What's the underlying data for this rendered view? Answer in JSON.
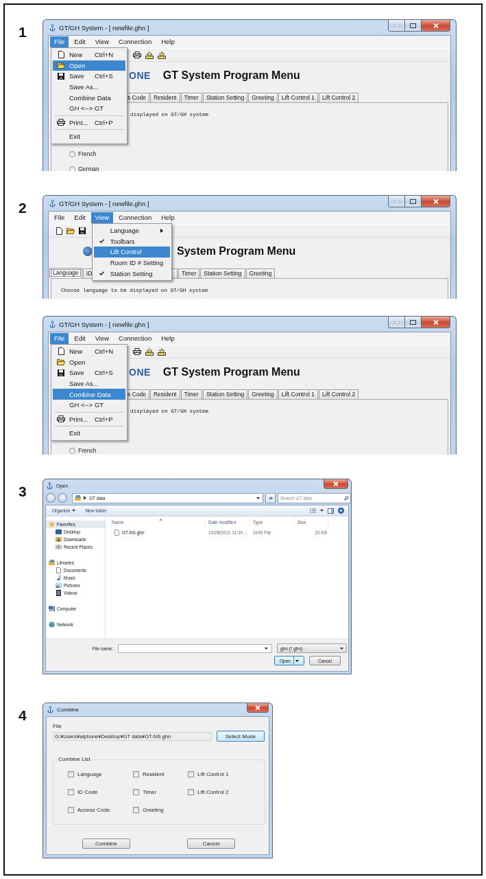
{
  "steps": [
    {
      "number": "1",
      "windows": [
        {
          "kind": "app",
          "title": "GT/GH System - [ newfile.ghn ]",
          "menubar": [
            {
              "label": "File",
              "selected": true,
              "dropdown": [
                {
                  "kind": "new",
                  "label": "New",
                  "shortcut": "Ctrl+N",
                  "selected": false
                },
                {
                  "kind": "open",
                  "label": "Open",
                  "selected": true
                },
                {
                  "kind": "save",
                  "label": "Save",
                  "shortcut": "Ctrl+S",
                  "selected": false
                },
                {
                  "kind": "plain",
                  "label": "Save As...",
                  "selected": false
                },
                {
                  "kind": "plain",
                  "label": "Combine Data",
                  "selected": false
                },
                {
                  "kind": "plain",
                  "label": "GH <--> GT",
                  "selected": false
                },
                {
                  "kind": "separator"
                },
                {
                  "kind": "print",
                  "label": "Print...",
                  "shortcut": "Ctrl+P",
                  "selected": false
                },
                {
                  "kind": "separator"
                },
                {
                  "kind": "plain",
                  "label": "Exit",
                  "selected": false
                }
              ]
            },
            {
              "label": "Edit",
              "selected": false
            },
            {
              "label": "View",
              "selected": false
            },
            {
              "label": "Connection",
              "selected": false
            },
            {
              "label": "Help",
              "selected": false
            }
          ],
          "toolbar": [
            {
              "kind": "print"
            },
            {
              "kind": "upload"
            },
            {
              "kind": "download"
            }
          ],
          "logo_text": "ONE",
          "heading": "GT System Program Menu",
          "tabs": [
            {
              "label": "s Code",
              "selected": false
            },
            {
              "label": "Resident",
              "selected": false
            },
            {
              "label": "Timer",
              "selected": false
            },
            {
              "label": "Station Setting",
              "selected": false
            },
            {
              "label": "Greeting",
              "selected": false
            },
            {
              "label": "Lift Control 1",
              "selected": false
            },
            {
              "label": "Lift Control 2",
              "selected": false
            }
          ],
          "prompt": "displayed on GT/GH system",
          "options": [
            {
              "label": "French",
              "selected": false
            },
            {
              "label": "German",
              "selected": false
            }
          ]
        }
      ]
    },
    {
      "number": "2",
      "windows": [
        {
          "kind": "app",
          "title": "GT/GH System - [ newfile.ghn ]",
          "menubar": [
            {
              "label": "File",
              "selected": false
            },
            {
              "label": "Edit",
              "selected": false
            },
            {
              "label": "View",
              "selected": true,
              "dropdown": [
                {
                  "kind": "check",
                  "label": "Language",
                  "submenu": true,
                  "checked": false,
                  "selected": false
                },
                {
                  "kind": "check",
                  "label": "Toolbars",
                  "checked": true,
                  "selected": false
                },
                {
                  "kind": "check",
                  "label": "Lift Control",
                  "checked": false,
                  "selected": true
                },
                {
                  "kind": "check",
                  "label": "Room ID # Setting",
                  "checked": false,
                  "selected": false
                },
                {
                  "kind": "check",
                  "label": "Station Setting",
                  "checked": true,
                  "selected": false
                }
              ]
            },
            {
              "label": "Connection",
              "selected": false
            },
            {
              "label": "Help",
              "selected": false
            }
          ],
          "toolbar": [
            {
              "kind": "new"
            },
            {
              "kind": "open"
            },
            {
              "kind": "save"
            }
          ],
          "logo_emblem": true,
          "heading": "System Program Menu",
          "tabs": [
            {
              "label": "Language",
              "selected": true
            },
            {
              "label": "ID",
              "selected": false
            },
            {
              "label": "Timer",
              "selected": false
            },
            {
              "label": "Station Setting",
              "selected": false
            },
            {
              "label": "Greeting",
              "selected": false
            }
          ],
          "prompt": "Choose language to be displayed on GT/GH system"
        },
        {
          "kind": "app",
          "title": "GT/GH System - [ newfile.ghn ]",
          "menubar": [
            {
              "label": "File",
              "selected": true,
              "dropdown": [
                {
                  "kind": "new",
                  "label": "New",
                  "shortcut": "Ctrl+N",
                  "selected": false
                },
                {
                  "kind": "open",
                  "label": "Open",
                  "selected": false
                },
                {
                  "kind": "save",
                  "label": "Save",
                  "shortcut": "Ctrl+S",
                  "selected": false
                },
                {
                  "kind": "plain",
                  "label": "Save As...",
                  "selected": false
                },
                {
                  "kind": "plain",
                  "label": "Combine Data",
                  "selected": true
                },
                {
                  "kind": "plain",
                  "label": "GH <--> GT",
                  "selected": false
                },
                {
                  "kind": "separator"
                },
                {
                  "kind": "print",
                  "label": "Print...",
                  "shortcut": "Ctrl+P",
                  "selected": false
                },
                {
                  "kind": "separator"
                },
                {
                  "kind": "plain",
                  "label": "Exit",
                  "selected": false
                }
              ]
            },
            {
              "label": "Edit",
              "selected": false
            },
            {
              "label": "View",
              "selected": false
            },
            {
              "label": "Connection",
              "selected": false
            },
            {
              "label": "Help",
              "selected": false
            }
          ],
          "toolbar": [
            {
              "kind": "print"
            },
            {
              "kind": "upload"
            },
            {
              "kind": "download"
            }
          ],
          "logo_text": "ONE",
          "heading": "GT System Program Menu",
          "tabs": [
            {
              "label": "s Code",
              "selected": false
            },
            {
              "label": "Resident",
              "selected": false
            },
            {
              "label": "Timer",
              "selected": false
            },
            {
              "label": "Station Setting",
              "selected": false
            },
            {
              "label": "Greeting",
              "selected": false
            },
            {
              "label": "Lift Control 1",
              "selected": false
            },
            {
              "label": "Lift Control 2",
              "selected": false
            }
          ],
          "prompt": "displayed on GT/GH system",
          "options": [
            {
              "label": "French",
              "selected": false
            }
          ]
        }
      ]
    },
    {
      "number": "3",
      "windows": [
        {
          "kind": "open_dialog",
          "title": "Open",
          "location": "GT data",
          "search": {
            "placeholder": "Search GT data"
          },
          "commands": [
            {
              "label": "Organize",
              "menu": true
            },
            {
              "label": "New folder",
              "menu": false
            }
          ],
          "nav": [
            {
              "label": "Favorites",
              "kind": "favorites",
              "selected": true,
              "children": [
                {
                  "label": "Desktop",
                  "kind": "desktop",
                  "selected": false
                },
                {
                  "label": "Downloads",
                  "kind": "downloads",
                  "selected": false
                },
                {
                  "label": "Recent Places",
                  "kind": "recent",
                  "selected": false
                }
              ]
            },
            {
              "label": "Libraries",
              "kind": "libraries",
              "selected": false,
              "children": [
                {
                  "label": "Documents",
                  "kind": "documents",
                  "selected": false
                },
                {
                  "label": "Music",
                  "kind": "music",
                  "selected": false
                },
                {
                  "label": "Pictures",
                  "kind": "pictures",
                  "selected": false
                },
                {
                  "label": "Videos",
                  "kind": "videos",
                  "selected": false
                }
              ]
            },
            {
              "label": "Computer",
              "kind": "computer",
              "selected": false
            },
            {
              "label": "Network",
              "kind": "network",
              "selected": false
            }
          ],
          "columns": [
            "Name",
            "Date modified",
            "Type",
            "Size"
          ],
          "files": [
            {
              "name": "GT-NS.ghn",
              "modified": "10/28/2010 11:39 ...",
              "type": "GHN File",
              "size": "20 KB"
            }
          ],
          "file_name_label": "File name:",
          "filter": "ghn (*.ghn)",
          "buttons": [
            {
              "label": "Open",
              "kind": "split"
            },
            {
              "label": "Cancel",
              "kind": "plain"
            }
          ]
        }
      ]
    },
    {
      "number": "4",
      "windows": [
        {
          "kind": "combine_dialog",
          "title": "Combine",
          "file_label": "File",
          "file_path": "G:¥Users¥aiphone¥Desktop¥GT data¥GT-NS.ghn",
          "select_button": "Select Mode",
          "group_label": "Combine List",
          "options": [
            {
              "label": "Language",
              "checked": false
            },
            {
              "label": "Resident",
              "checked": false
            },
            {
              "label": "Lift Control 1",
              "checked": false
            },
            {
              "label": "ID Code",
              "checked": false
            },
            {
              "label": "Timer",
              "checked": false
            },
            {
              "label": "Lift Control 2",
              "checked": false
            },
            {
              "label": "Access Code",
              "checked": false
            },
            {
              "label": "Greeting",
              "checked": false
            }
          ],
          "buttons": [
            "Combine",
            "Cancel"
          ]
        }
      ]
    }
  ]
}
